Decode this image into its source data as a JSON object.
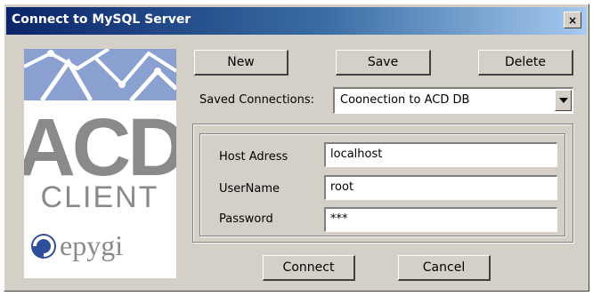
{
  "window": {
    "title": "Connect to MySQL Server",
    "close_symbol": "×",
    "close_icon": "close-icon"
  },
  "logo": {
    "text_main": "ACD",
    "text_sub": "CLIENT",
    "brand": "epygi",
    "brand_color": "#2e4e9c",
    "logo_gray": "#8a8a8a"
  },
  "toolbar": {
    "new_label": "New",
    "save_label": "Save",
    "delete_label": "Delete"
  },
  "saved_connections": {
    "label": "Saved Connections:",
    "value": "Coonection to ACD DB",
    "arrow_icon": "chevron-down-icon"
  },
  "form": {
    "host_label": "Host Adress",
    "host_value": "localhost",
    "user_label": "UserName",
    "user_value": "root",
    "password_label": "Password",
    "password_value": "***"
  },
  "actions": {
    "connect_label": "Connect",
    "cancel_label": "Cancel"
  },
  "colors": {
    "title_start": "#0a246a",
    "title_end": "#a6caf0",
    "face": "#d4d0c8"
  }
}
